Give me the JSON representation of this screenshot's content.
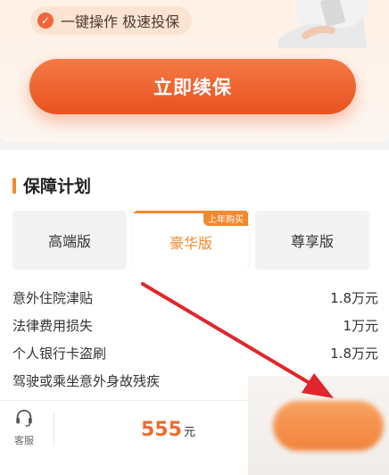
{
  "hero": {
    "feature_text": "一键操作 极速投保",
    "renew_label": "立即续保"
  },
  "plan": {
    "title": "保障计划",
    "tabs": [
      {
        "label": "高端版",
        "active": false
      },
      {
        "label": "豪华版",
        "active": true,
        "badge": "上年购买"
      },
      {
        "label": "尊享版",
        "active": false
      }
    ],
    "coverage": [
      {
        "name": "意外住院津贴",
        "value": "1.8万元"
      },
      {
        "name": "法律费用损失",
        "value": "1万元"
      },
      {
        "name": "个人银行卡盗刷",
        "value": "1.8万元"
      },
      {
        "name": "驾驶或乘坐意外身故残疾",
        "value": ""
      }
    ]
  },
  "bottom": {
    "service_label": "客服",
    "price": "555",
    "price_unit": "元"
  },
  "colors": {
    "accent": "#ef6a2b",
    "title_bar": "#f08a2e",
    "arrow": "#e0262c"
  },
  "icons": {
    "check": "check-icon",
    "headset": "headset-icon"
  }
}
